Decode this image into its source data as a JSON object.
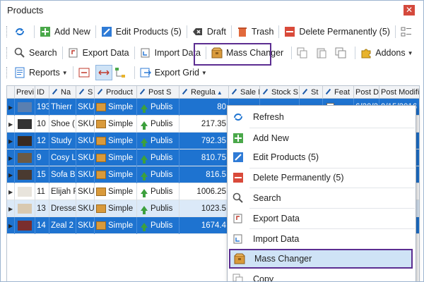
{
  "window": {
    "title": "Products",
    "close": "✕"
  },
  "toolbar1": {
    "add_new": "Add New",
    "edit_products": "Edit Products (5)",
    "draft": "Draft",
    "trash": "Trash",
    "delete_perm": "Delete Permanently (5)"
  },
  "toolbar2": {
    "search": "Search",
    "export_data": "Export Data",
    "import_data": "Import Data",
    "mass_changer": "Mass Changer",
    "addons": "Addons"
  },
  "toolbar3": {
    "reports": "Reports",
    "export_grid": "Export Grid"
  },
  "grid": {
    "headers": [
      "Previ",
      "ID",
      "Na",
      "S",
      "Product",
      "Post S",
      "Regula",
      "Sale I",
      "Stock S",
      "St",
      "Feat",
      "Post Da",
      "Post Modifi"
    ],
    "rows": [
      {
        "id": "193",
        "name": "Thierr",
        "sku": "SKU_",
        "type": "Simple",
        "status": "Publis",
        "price": "80"
      },
      {
        "id": "10",
        "name": "Shoe (",
        "sku": "SKU_",
        "type": "Simple",
        "status": "Publis",
        "price": "217.35"
      },
      {
        "id": "12",
        "name": "Study",
        "sku": "SKU_",
        "type": "Simple",
        "status": "Publis",
        "price": "792.35"
      },
      {
        "id": "9",
        "name": "Cosy L",
        "sku": "SKU_",
        "type": "Simple",
        "status": "Publis",
        "price": "810.75"
      },
      {
        "id": "15",
        "name": "Sofa B",
        "sku": "SKU_",
        "type": "Simple",
        "status": "Publis",
        "price": "816.5"
      },
      {
        "id": "11",
        "name": "Elijah F",
        "sku": "SKU_",
        "type": "Simple",
        "status": "Publis",
        "price": "1006.25"
      },
      {
        "id": "13",
        "name": "Dresse",
        "sku": "SKU4",
        "type": "Simple",
        "status": "Publis",
        "price": "1023.5"
      },
      {
        "id": "14",
        "name": "Zeal 2",
        "sku": "SKU_",
        "type": "Simple",
        "status": "Publis",
        "price": "1674.4"
      }
    ],
    "row0_extra": {
      "date": "6/20/2",
      "modified": "9/15/2016"
    },
    "right_edge_values": [
      "6",
      "6",
      "6",
      "6",
      "6",
      "6",
      "5",
      "6"
    ]
  },
  "context_menu": {
    "items": [
      "Refresh",
      "Add New",
      "Edit Products (5)",
      "Delete Permanently (5)",
      "Search",
      "Export Data",
      "Import Data",
      "Mass Changer",
      "Copy"
    ]
  },
  "colors": {
    "selection": "#1e73d0",
    "highlight_border": "#5c2d91",
    "menu_hover": "#cfe3f6"
  }
}
